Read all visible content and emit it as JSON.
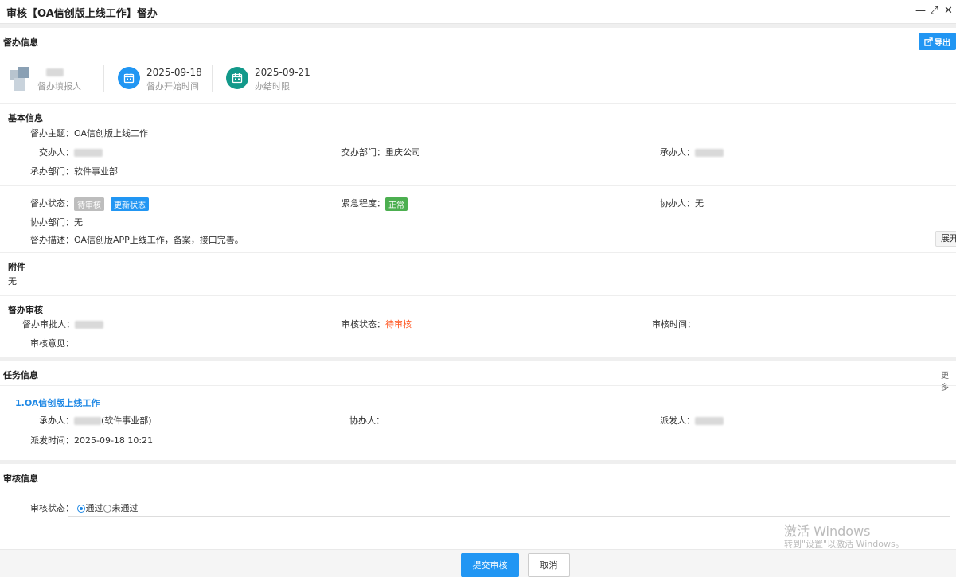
{
  "window": {
    "title": "审核【OA信创版上线工作】督办",
    "min_glyph": "—",
    "max_glyph": "⤢",
    "close_glyph": "✕"
  },
  "supervise": {
    "section_title": "督办信息",
    "export_label": "导出",
    "filler_label": "督办填报人",
    "start_date": "2025-09-18",
    "start_label": "督办开始时间",
    "end_date": "2025-09-21",
    "end_label": "办结时限",
    "icon_blue": "#2196f3",
    "icon_teal": "#12998a"
  },
  "basic": {
    "title": "基本信息",
    "topic_label": "督办主题：",
    "topic_value": "OA信创版上线工作",
    "assigner_label": "交办人：",
    "assign_dept_label": "交办部门：",
    "assign_dept_value": "重庆公司",
    "handler_label": "承办人：",
    "handler_dept_label": "承办部门：",
    "handler_dept_value": "软件事业部",
    "status_label": "督办状态：",
    "status_value": "待审核",
    "update_status_label": "更新状态",
    "urgency_label": "紧急程度：",
    "urgency_value": "正常",
    "assistant_label": "协办人：",
    "assistant_value": "无",
    "assist_dept_label": "协办部门：",
    "assist_dept_value": "无",
    "desc_label": "督办描述：",
    "desc_value": "OA信创版APP上线工作，备案，接口完善。",
    "expand_label": "展开"
  },
  "attachment": {
    "title": "附件",
    "value": "无"
  },
  "audit": {
    "title": "督办审核",
    "approver_label": "督办审批人：",
    "status_label": "审核状态：",
    "status_value": "待审核",
    "time_label": "审核时间：",
    "opinion_label": "审核意见："
  },
  "task": {
    "section_title": "任务信息",
    "more_label": "更多",
    "item_title": "1.OA信创版上线工作",
    "handler_label": "承办人：",
    "handler_dept": "(软件事业部)",
    "assistant_label": "协办人：",
    "dispatcher_label": "派发人：",
    "dispatch_time_label": "派发时间：",
    "dispatch_time_value": "2025-09-18 10:21"
  },
  "review": {
    "section_title": "审核信息",
    "status_label": "审核状态：",
    "pass_label": "通过",
    "fail_label": "未通过"
  },
  "watermark": {
    "line1": "激活 Windows",
    "line2": "转到\"设置\"以激活 Windows。"
  },
  "footer": {
    "submit_label": "提交审核",
    "cancel_label": "取消"
  }
}
